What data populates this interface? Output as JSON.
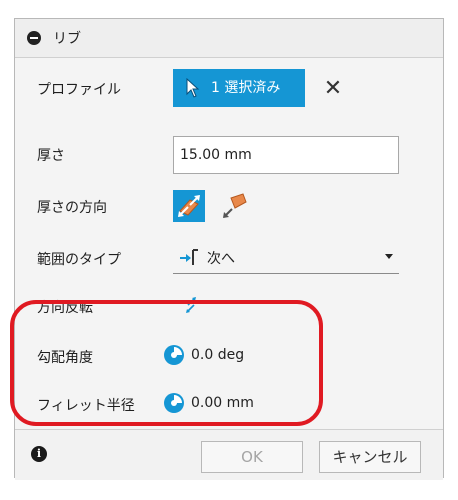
{
  "dialog": {
    "title": "リブ",
    "rows": {
      "profile": {
        "label": "プロファイル",
        "button_text": "1 選択済み",
        "clear_icon": "✕"
      },
      "thickness": {
        "label": "厚さ",
        "value": "15.00 mm"
      },
      "thickness_direction": {
        "label": "厚さの方向"
      },
      "extent_type": {
        "label": "範囲のタイプ",
        "value": "次へ"
      },
      "flip_direction": {
        "label": "方向反転"
      },
      "draft_angle": {
        "label": "勾配角度",
        "value": "0.0 deg"
      },
      "fillet_radius": {
        "label": "フィレット半径",
        "value": "0.00 mm"
      }
    },
    "footer": {
      "info_icon": "i",
      "ok_label": "OK",
      "cancel_label": "キャンセル"
    }
  },
  "colors": {
    "accent": "#1596d4",
    "highlight": "#e01a22",
    "orange": "#e8884a"
  },
  "icons": [
    "collapse-icon",
    "cursor-icon",
    "close-icon",
    "direction-symmetric-icon",
    "direction-one-side-icon",
    "to-next-icon",
    "flip-icon",
    "dial-icon",
    "info-icon"
  ]
}
